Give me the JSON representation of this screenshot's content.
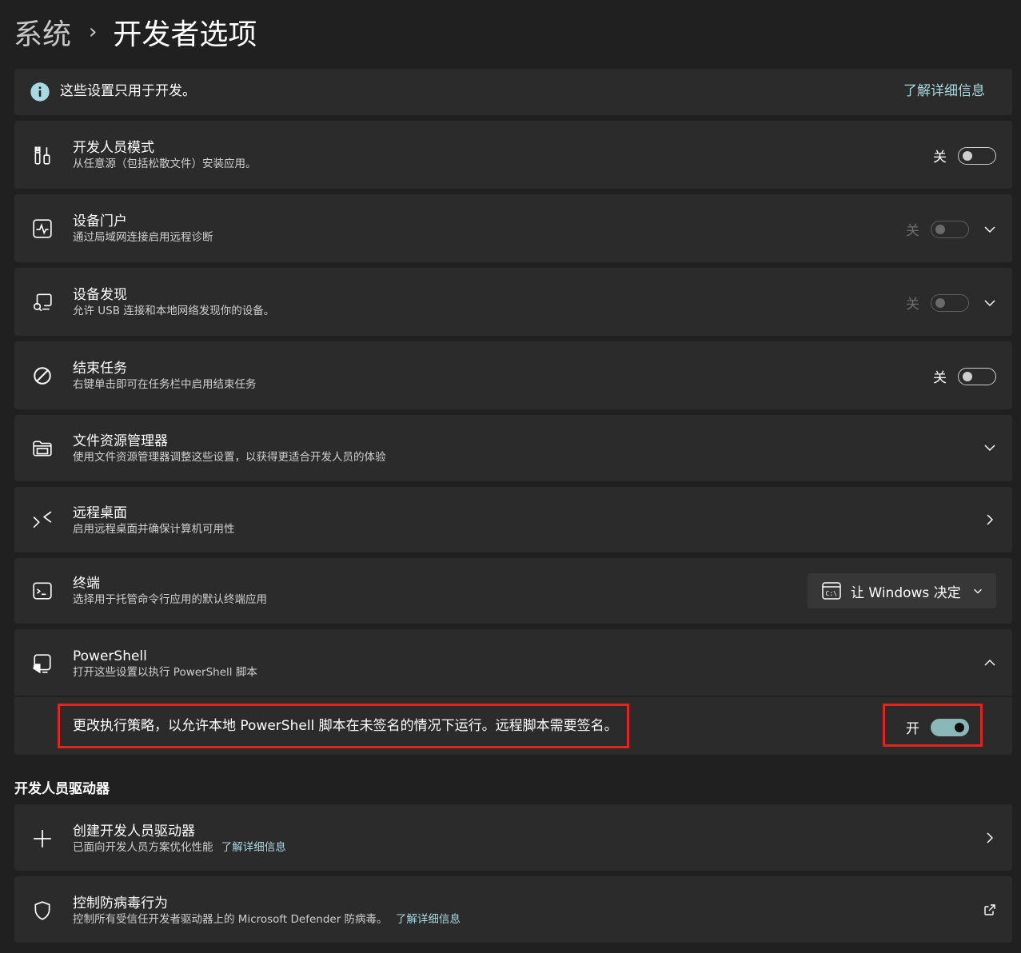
{
  "breadcrumb": {
    "parent": "系统",
    "separator": "›",
    "current": "开发者选项"
  },
  "info_bar": {
    "text": "这些设置只用于开发。",
    "link": "了解详细信息"
  },
  "settings": {
    "dev_mode": {
      "title": "开发人员模式",
      "subtitle": "从任意源（包括松散文件）安装应用。",
      "state": "关"
    },
    "device_portal": {
      "title": "设备门户",
      "subtitle": "通过局域网连接启用远程诊断",
      "state": "关"
    },
    "device_discovery": {
      "title": "设备发现",
      "subtitle": "允许 USB 连接和本地网络发现你的设备。",
      "state": "关"
    },
    "end_task": {
      "title": "结束任务",
      "subtitle": "右键单击即可在任务栏中启用结束任务",
      "state": "关"
    },
    "file_explorer": {
      "title": "文件资源管理器",
      "subtitle": "使用文件资源管理器调整这些设置，以获得更适合开发人员的体验"
    },
    "remote_desktop": {
      "title": "远程桌面",
      "subtitle": "启用远程桌面并确保计算机可用性"
    },
    "terminal": {
      "title": "终端",
      "subtitle": "选择用于托管命令行应用的默认终端应用",
      "dropdown": "让 Windows 决定"
    },
    "powershell": {
      "title": "PowerShell",
      "subtitle": "打开这些设置以执行 PowerShell 脚本",
      "policy_text": "更改执行策略，以允许本地 PowerShell 脚本在未签名的情况下运行。远程脚本需要签名。",
      "policy_state": "开"
    }
  },
  "dev_drive": {
    "section_title": "开发人员驱动器",
    "create": {
      "title": "创建开发人员驱动器",
      "subtitle": "已面向开发人员方案优化性能",
      "link": "了解详细信息"
    },
    "antivirus": {
      "title": "控制防病毒行为",
      "subtitle": "控制所有受信任开发者驱动器上的 Microsoft Defender 防病毒。",
      "link": "了解详细信息"
    }
  },
  "colors": {
    "background": "#202020",
    "card": "#2b2b2b",
    "accent": "#8ab8b8",
    "highlight_border": "#e0251c",
    "link": "#a8d8e0"
  }
}
